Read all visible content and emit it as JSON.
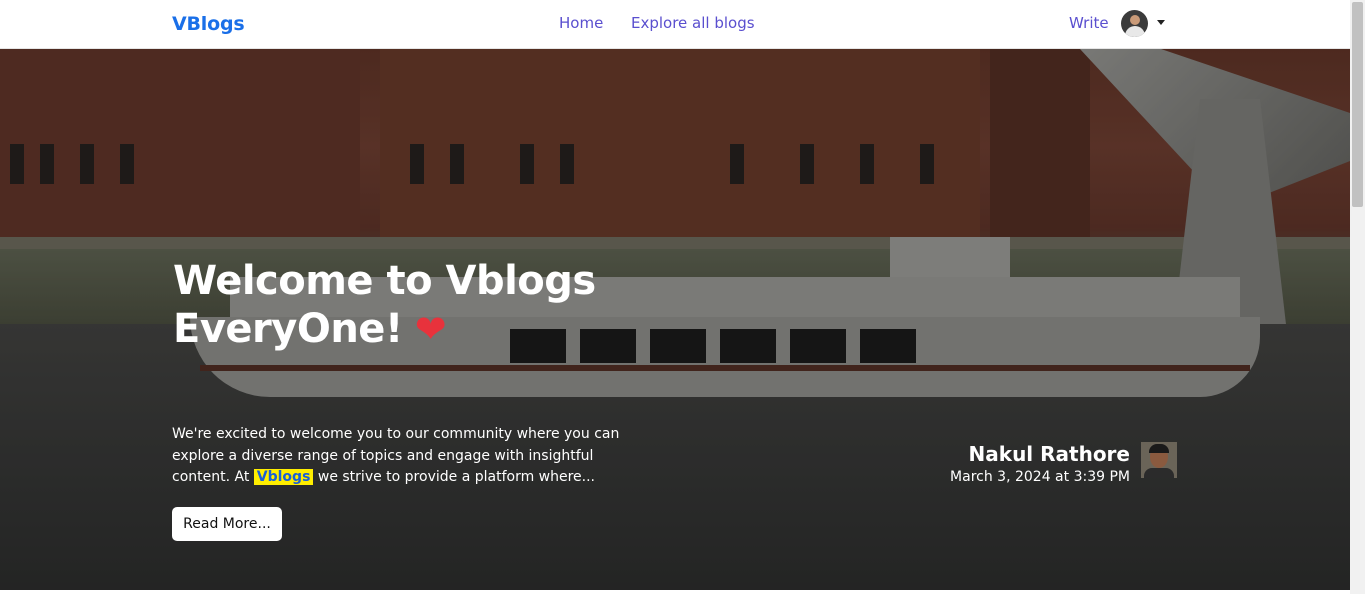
{
  "nav": {
    "brand": "VBlogs",
    "links": [
      {
        "label": "Home"
      },
      {
        "label": "Explore all blogs"
      }
    ],
    "write_label": "Write"
  },
  "hero": {
    "title_line1": "Welcome to Vblogs",
    "title_line2": "EveryOne!",
    "title_icon": "heart-icon",
    "desc_before": "We're excited to welcome you to our community where you can explore a diverse range of topics and engage with insightful content. At",
    "desc_highlight": "Vblogs",
    "desc_after": "we strive to provide a platform where...",
    "read_more_label": "Read More..."
  },
  "author": {
    "name": "Nakul Rathore",
    "date": "March 3, 2024 at 3:39 PM"
  },
  "colors": {
    "brand": "#1a6fe8",
    "nav_link": "#5a4fcf",
    "highlight_bg": "#ffee00",
    "heart": "#e8323c"
  }
}
